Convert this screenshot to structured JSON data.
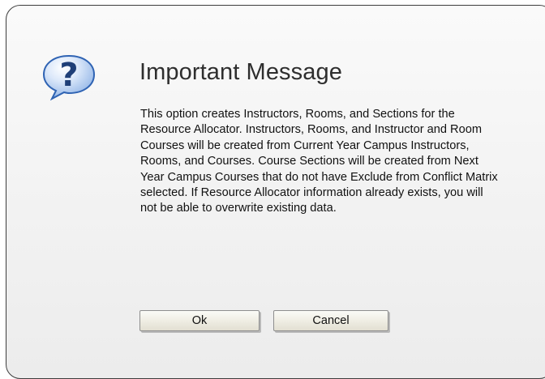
{
  "dialog": {
    "icon": "question-mark-help-icon",
    "title": "Important Message",
    "message": "This option creates Instructors, Rooms, and Sections for the Resource Allocator. Instructors, Rooms, and Instructor and Room Courses will be created from Current Year Campus Instructors, Rooms, and Courses. Course Sections will be created from Next Year Campus Courses that do not have Exclude from Conflict Matrix selected. If Resource Allocator information already exists, you will not be able to overwrite existing data.",
    "buttons": {
      "ok_label": "Ok",
      "cancel_label": "Cancel"
    }
  },
  "colors": {
    "icon_blue": "#3f7fd6",
    "icon_border": "#1d4f9c",
    "title_text": "#2e2e2e",
    "dialog_border": "#3d3d3d"
  }
}
